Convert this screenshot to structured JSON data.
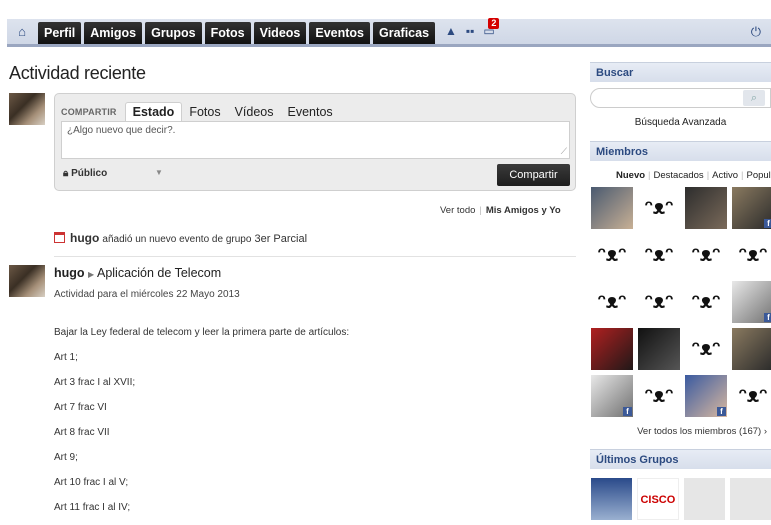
{
  "nav": {
    "tabs": [
      "Perfil",
      "Amigos",
      "Grupos",
      "Fotos",
      "Videos",
      "Eventos",
      "Graficas"
    ],
    "notifications_count": "2"
  },
  "main": {
    "title": "Actividad reciente",
    "composer": {
      "label": "COMPARTIR",
      "tabs": [
        "Estado",
        "Fotos",
        "Vídeos",
        "Eventos"
      ],
      "placeholder": "¿Algo nuevo que decir?.",
      "privacy": "Público",
      "share_button": "Compartir"
    },
    "filters": {
      "all": "Ver todo",
      "mine": "Mis Amigos y Yo"
    },
    "event": {
      "user": "hugo",
      "text": "añadió un nuevo evento de grupo",
      "group": "3er Parcial"
    },
    "post": {
      "user": "hugo",
      "target": "Aplicación de Telecom",
      "subtitle": "Actividad para el miércoles 22 Mayo 2013",
      "lines": [
        "Bajar la Ley federal de telecom y leer la primera parte de artículos:",
        "Art 1;",
        "Art 3 frac I al XVII;",
        "Art 7 frac VI",
        "Art 8 frac VII",
        "Art 9;",
        "Art 10 frac I al V;",
        "Art 11 frac I al IV;"
      ]
    }
  },
  "sidebar": {
    "search_title": "Buscar",
    "advanced_search": "Búsqueda Avanzada",
    "members_title": "Miembros",
    "member_tabs": [
      "Nuevo",
      "Destacados",
      "Activo",
      "Popula"
    ],
    "view_all_members": "Ver todos los miembros (167) ›",
    "groups_title": "Últimos Grupos",
    "cisco_logo_text": "CISCO"
  }
}
